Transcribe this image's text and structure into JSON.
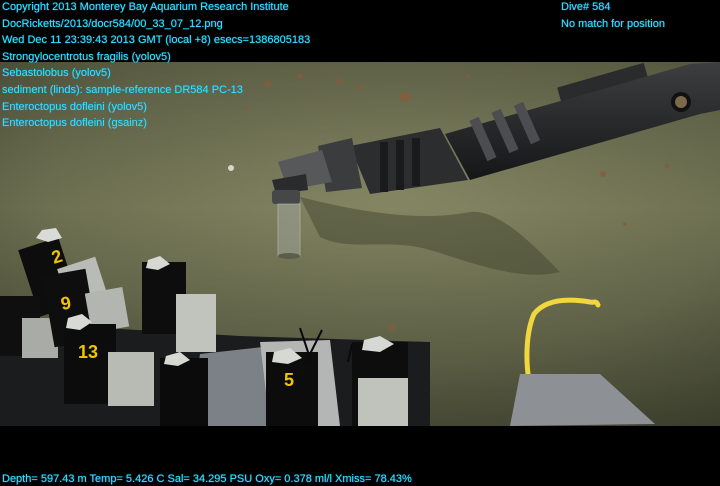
{
  "header_left": [
    "Copyright 2013 Monterey Bay Aquarium Research Institute",
    "DocRicketts/2013/docr584/00_33_07_12.png",
    "Wed Dec 11 23:39:43 2013 GMT (local +8)  esecs=1386805183",
    "Strongylocentrotus fragilis (yolov5)",
    "Sebastolobus (yolov5)",
    "sediment (linds): sample-reference DR584 PC-13",
    "Enteroctopus dofleini (yolov5)",
    "Enteroctopus dofleini (gsainz)"
  ],
  "header_right": [
    "Dive# 584",
    "No match for position"
  ],
  "footer": "Depth= 597.43 m  Temp= 5.426 C  Sal= 34.295 PSU  Oxy= 0.378 ml/l  Xmiss= 78.43%",
  "core_tube_labels": [
    "2",
    "9",
    "13",
    "5"
  ],
  "colors": {
    "overlay_text": "#35e0ff",
    "seafloor": "#6f7250",
    "background": "#000000"
  }
}
